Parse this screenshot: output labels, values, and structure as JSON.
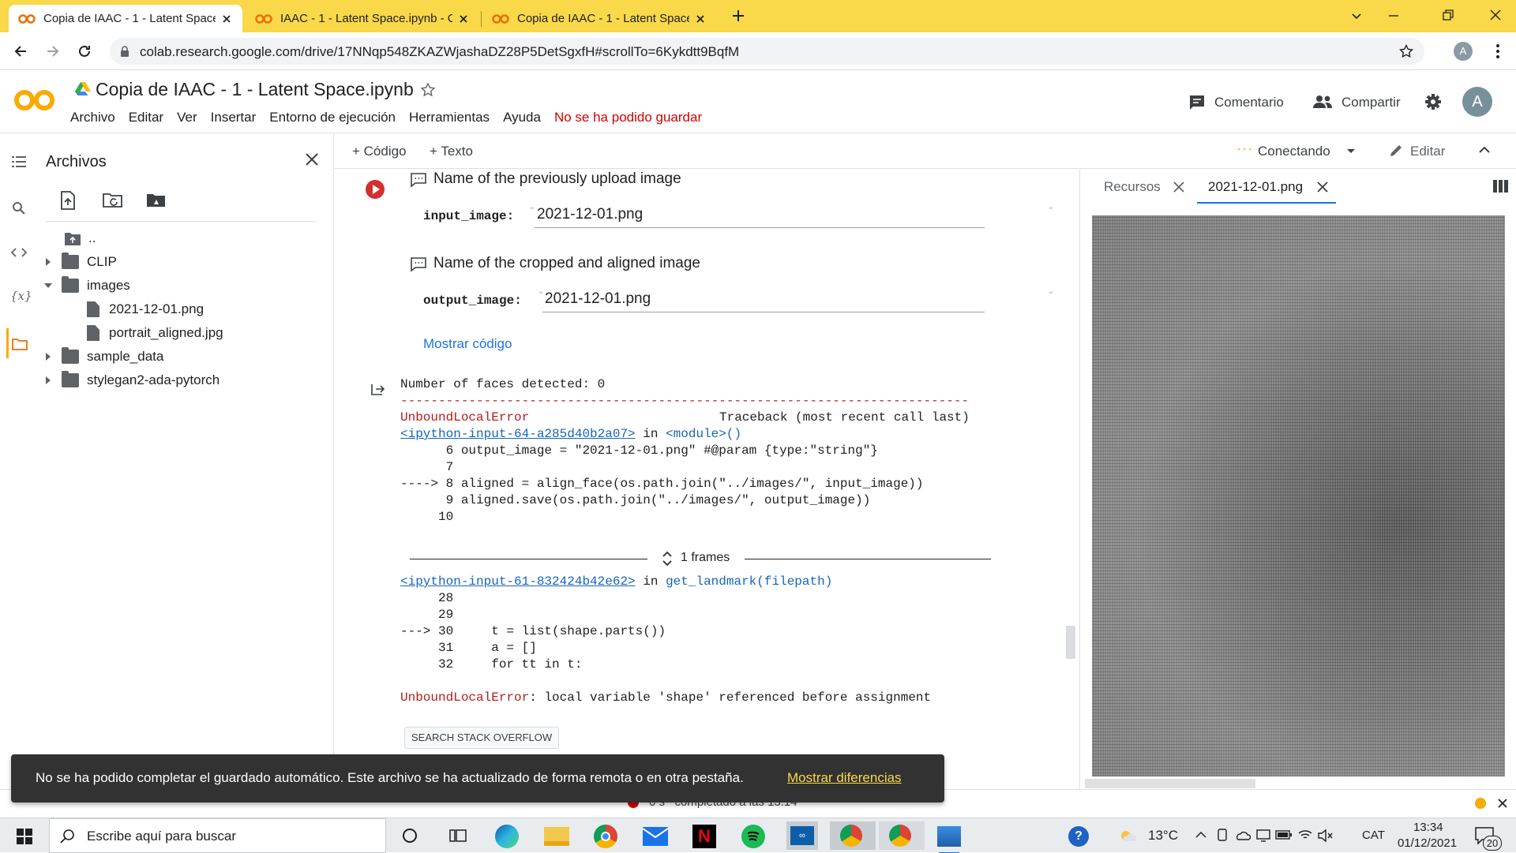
{
  "browser": {
    "tabs": [
      {
        "title": "Copia de IAAC - 1 - Latent Space",
        "active": true
      },
      {
        "title": "IAAC - 1 - Latent Space.ipynb - C",
        "active": false
      },
      {
        "title": "Copia de IAAC - 1 - Latent Space",
        "active": false
      }
    ],
    "url": "colab.research.google.com/drive/17NNqp548ZKAZWjashaDZ28P5DetSgxfH#scrollTo=6Kykdtt9BqfM",
    "profile_initial": "A"
  },
  "colab": {
    "logo": "CO",
    "title": "Copia de IAAC - 1 - Latent Space.ipynb",
    "menu": [
      "Archivo",
      "Editar",
      "Ver",
      "Insertar",
      "Entorno de ejecución",
      "Herramientas",
      "Ayuda"
    ],
    "save_error": "No se ha podido guardar",
    "comment_label": "Comentario",
    "share_label": "Compartir",
    "avatar_initial": "A"
  },
  "toolbar": {
    "add_code": "+ Código",
    "add_text": "+ Texto",
    "connecting": "Conectando",
    "edit": "Editar"
  },
  "sidebar": {
    "title": "Archivos",
    "items": [
      {
        "label": "..",
        "type": "up"
      },
      {
        "label": "CLIP",
        "type": "folder"
      },
      {
        "label": "images",
        "type": "folder-open"
      },
      {
        "label": "2021-12-01.png",
        "type": "file"
      },
      {
        "label": "portrait_aligned.jpg",
        "type": "file"
      },
      {
        "label": "sample_data",
        "type": "folder"
      },
      {
        "label": "stylegan2-ada-pytorch",
        "type": "folder"
      }
    ]
  },
  "cell": {
    "comment1": "Name of the previously upload image",
    "param1_label": "input_image:",
    "param1_value": "2021-12-01.png",
    "comment2": "Name of the cropped and aligned image",
    "param2_label": "output_image:",
    "param2_value": "2021-12-01.png",
    "show_code": "Mostrar código"
  },
  "output": {
    "line1": "Number of faces detected: 0",
    "dashes": "---------------------------------------------------------------------------",
    "err_name": "UnboundLocalError",
    "traceback": "Traceback (most recent call last)",
    "input64": "<ipython-input-64-a285d40b2a07>",
    "in": " in ",
    "module": "<module>()",
    "l6": "      6 output_image = \"2021-12-01.png\" #@param {type:\"string\"}",
    "l7": "      7",
    "l8": "----> 8 aligned = align_face(os.path.join(\"../images/\", input_image))",
    "l9": "      9 aligned.save(os.path.join(\"../images/\", output_image))",
    "l10": "     10",
    "frames": "1 frames",
    "input61": "<ipython-input-61-832424b42e62>",
    "func": "get_landmark(filepath)",
    "l28": "     28",
    "l29": "     29",
    "l30": "---> 30     t = list(shape.parts())",
    "l31": "     31     a = []",
    "l32": "     32     for tt in t:",
    "final_err": "UnboundLocalError",
    "final_msg": ": local variable 'shape' referenced before assignment",
    "so_button": "SEARCH STACK OVERFLOW"
  },
  "right_panel": {
    "tab1": "Recursos",
    "tab2": "2021-12-01.png"
  },
  "snackbar": {
    "message": "No se ha podido completar el guardado automático. Este archivo se ha actualizado de forma remota o en otra pestaña.",
    "action": "Mostrar diferencias"
  },
  "statusbar": {
    "text": "0 s   completado a las 13:14"
  },
  "taskbar": {
    "search_placeholder": "Escribe aquí para buscar",
    "temperature": "13°C",
    "lang": "CAT",
    "time": "13:34",
    "date": "01/12/2021",
    "notifications": "20"
  },
  "colors": {
    "accent": "#f9d84a",
    "colab_orange": "#f9ab00",
    "error_red": "#d50000",
    "link_blue": "#1a73e8"
  }
}
